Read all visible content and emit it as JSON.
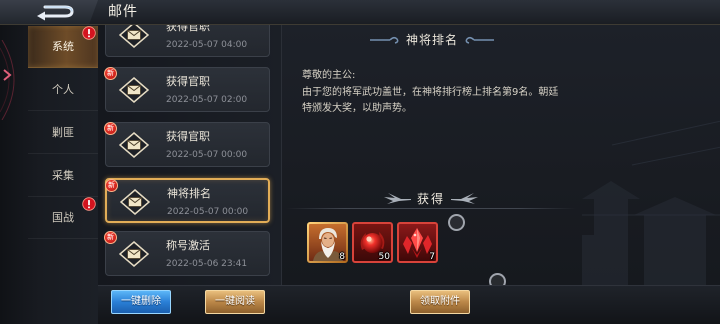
{
  "header": {
    "title": "邮件",
    "back_icon": "back-arrow-icon"
  },
  "sidebar": {
    "expand_icon": "chevron-right-icon",
    "tabs": [
      {
        "label": "系统",
        "selected": true,
        "alert": true
      },
      {
        "label": "个人",
        "selected": false,
        "alert": false
      },
      {
        "label": "剿匪",
        "selected": false,
        "alert": false
      },
      {
        "label": "采集",
        "selected": false,
        "alert": false
      },
      {
        "label": "国战",
        "selected": false,
        "alert": true
      }
    ]
  },
  "mail_list": {
    "new_badge_label": "新",
    "item_icon": "envelope-icon",
    "items": [
      {
        "title": "获得官职",
        "date": "2022-05-07 04:00",
        "selected": false
      },
      {
        "title": "获得官职",
        "date": "2022-05-07 02:00",
        "new": true,
        "selected": false
      },
      {
        "title": "获得官职",
        "date": "2022-05-07 00:00",
        "new": true,
        "selected": false
      },
      {
        "title": "神将排名",
        "date": "2022-05-07 00:00",
        "new": true,
        "selected": true
      },
      {
        "title": "称号激活",
        "date": "2022-05-06 23:41",
        "new": true,
        "selected": false
      }
    ]
  },
  "message": {
    "title": "神将排名",
    "greeting": "尊敬的主公:",
    "body_lines": [
      "由于您的将军武功盖世，在神将排行榜上排名第9名。朝廷",
      "特颁发大奖，以助声势。"
    ],
    "rewards_title": "获得",
    "rewards": [
      {
        "icon": "general-portrait-icon",
        "count": "8"
      },
      {
        "icon": "red-orb-icon",
        "count": "50"
      },
      {
        "icon": "red-gem-cluster-icon",
        "count": "7"
      }
    ]
  },
  "actions": {
    "delete_all": "一键删除",
    "read_all": "一键阅读",
    "claim_attachments": "领取附件"
  },
  "colors": {
    "accent_gold": "#e2ad57",
    "alert_red": "#d3141f",
    "primary_blue": "#2a7fd6"
  }
}
